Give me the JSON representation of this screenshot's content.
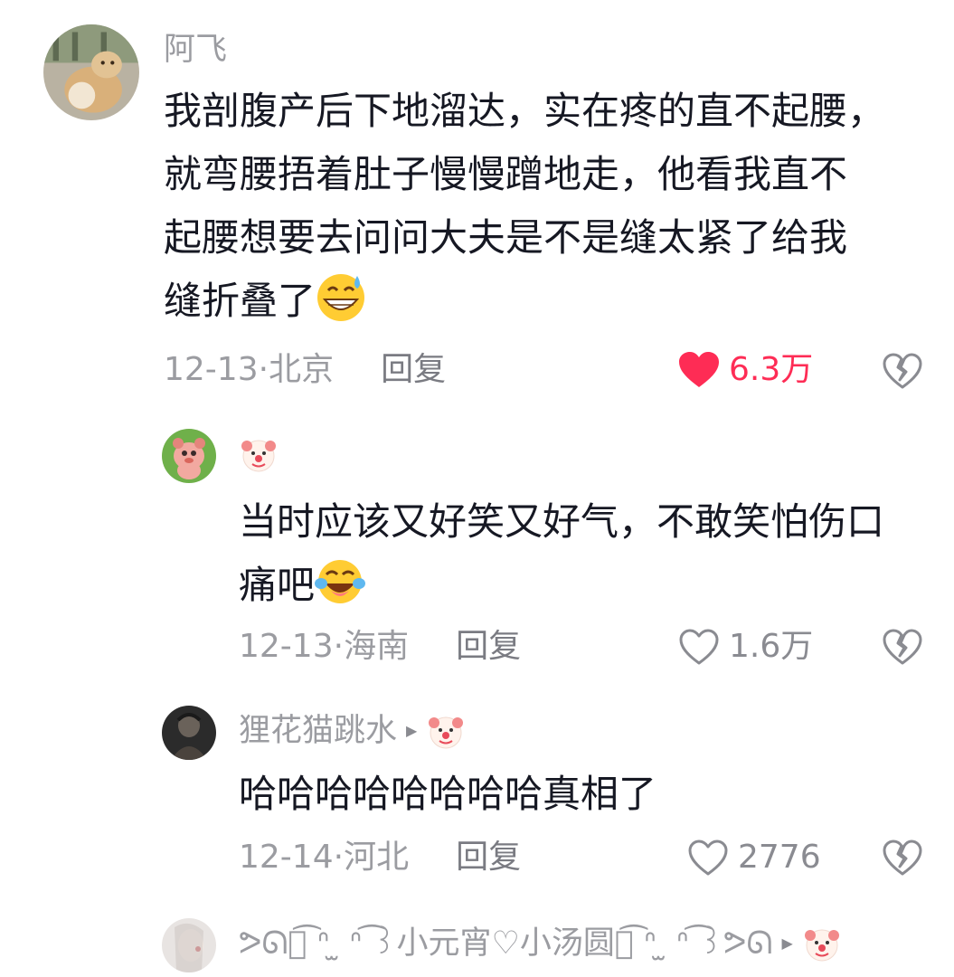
{
  "comments": [
    {
      "username": "阿飞",
      "lines": [
        "我剖腹产后下地溜达，实在疼的直不起腰，",
        "就弯腰捂着肚子慢慢蹭地走，他看我直不",
        "起腰想要去问问大夫是不是缝太紧了给我",
        "缝折叠了"
      ],
      "emoji": "grinning-sweat-emoji",
      "date": "12-13",
      "location": "北京",
      "reply_label": "回复",
      "likes": "6.3万",
      "liked": true
    },
    {
      "username_icon": "clown-face-icon",
      "lines": [
        "当时应该又好笑又好气，不敢笑怕伤口",
        "痛吧"
      ],
      "emoji": "tears-of-joy-emoji",
      "date": "12-13",
      "location": "海南",
      "reply_label": "回复",
      "likes": "1.6万",
      "liked": false
    },
    {
      "username": "狸花猫跳水",
      "reply_to_icon": "clown-face-icon",
      "lines": [
        "哈哈哈哈哈哈哈哈真相了"
      ],
      "date": "12-14",
      "location": "河北",
      "reply_label": "回复",
      "likes": "2776",
      "liked": false
    },
    {
      "username": "ᕗᘏ꒰͡ ᐢ ̫ ᐢ ͡꒱小元宵♡小汤圆꒰͡ ᐢ ̫ ᐢ ͡꒱ᕗᘏ",
      "reply_to_icon": "clown-face-icon"
    }
  ],
  "colors": {
    "like_active": "#fe2c55",
    "meta_gray": "#9b9ca1",
    "text": "#161823"
  },
  "separator": " · "
}
